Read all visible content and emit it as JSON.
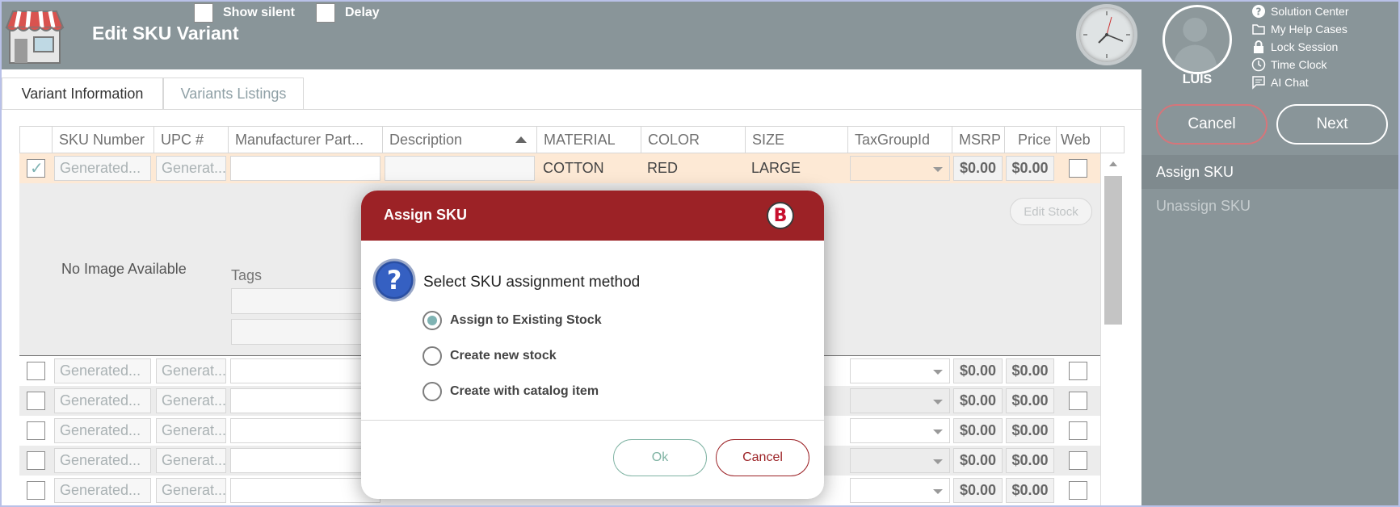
{
  "header": {
    "title": "Edit SKU Variant",
    "options": [
      {
        "label": "Show silent",
        "checked": false
      },
      {
        "label": "Delay",
        "checked": false
      }
    ]
  },
  "user": {
    "name": "LUIS"
  },
  "help_links": [
    {
      "label": "Solution Center",
      "icon": "question-circle-icon"
    },
    {
      "label": "My Help Cases",
      "icon": "folder-icon"
    },
    {
      "label": "Lock Session",
      "icon": "lock-icon"
    },
    {
      "label": "Time Clock",
      "icon": "clock-icon"
    },
    {
      "label": "AI Chat",
      "icon": "chat-icon"
    }
  ],
  "actions": {
    "cancel": "Cancel",
    "next": "Next"
  },
  "side_menu": [
    {
      "label": "Assign SKU",
      "active": true
    },
    {
      "label": "Unassign SKU",
      "active": false
    }
  ],
  "tabs": [
    {
      "label": "Variant Information",
      "active": true
    },
    {
      "label": "Variants Listings",
      "active": false
    }
  ],
  "grid": {
    "columns": [
      "SKU Number",
      "UPC #",
      "Manufacturer Part...",
      "Description",
      "MATERIAL",
      "COLOR",
      "SIZE",
      "TaxGroupId",
      "MSRP",
      "Price",
      "Web"
    ],
    "selected_row": {
      "sku": "Generated...",
      "upc": "Generat...",
      "material": "COTTON",
      "color": "RED",
      "size": "LARGE",
      "msrp": "$0.00",
      "price": "$0.00"
    },
    "detail": {
      "no_image": "No Image Available",
      "tags_label": "Tags",
      "edit_stock": "Edit Stock"
    },
    "rows": [
      {
        "sku": "Generated...",
        "upc": "Generat...",
        "msrp": "$0.00",
        "price": "$0.00"
      },
      {
        "sku": "Generated...",
        "upc": "Generat...",
        "msrp": "$0.00",
        "price": "$0.00"
      },
      {
        "sku": "Generated...",
        "upc": "Generat...",
        "msrp": "$0.00",
        "price": "$0.00"
      },
      {
        "sku": "Generated...",
        "upc": "Generat...",
        "msrp": "$0.00",
        "price": "$0.00"
      },
      {
        "sku": "Generated...",
        "upc": "Generat...",
        "msrp": "$0.00",
        "price": "$0.00"
      }
    ]
  },
  "modal": {
    "title": "Assign SKU",
    "logo_text": "B",
    "prompt": "Select SKU assignment method",
    "options": [
      {
        "label": "Assign to Existing Stock",
        "checked": true
      },
      {
        "label": "Create new stock",
        "checked": false
      },
      {
        "label": "Create with catalog item",
        "checked": false
      }
    ],
    "ok": "Ok",
    "cancel": "Cancel"
  },
  "colors": {
    "header_bg": "#899599",
    "modal_header": "#9c2226",
    "accent_teal": "#7fb3b3",
    "selected_row": "#fde9d5"
  }
}
